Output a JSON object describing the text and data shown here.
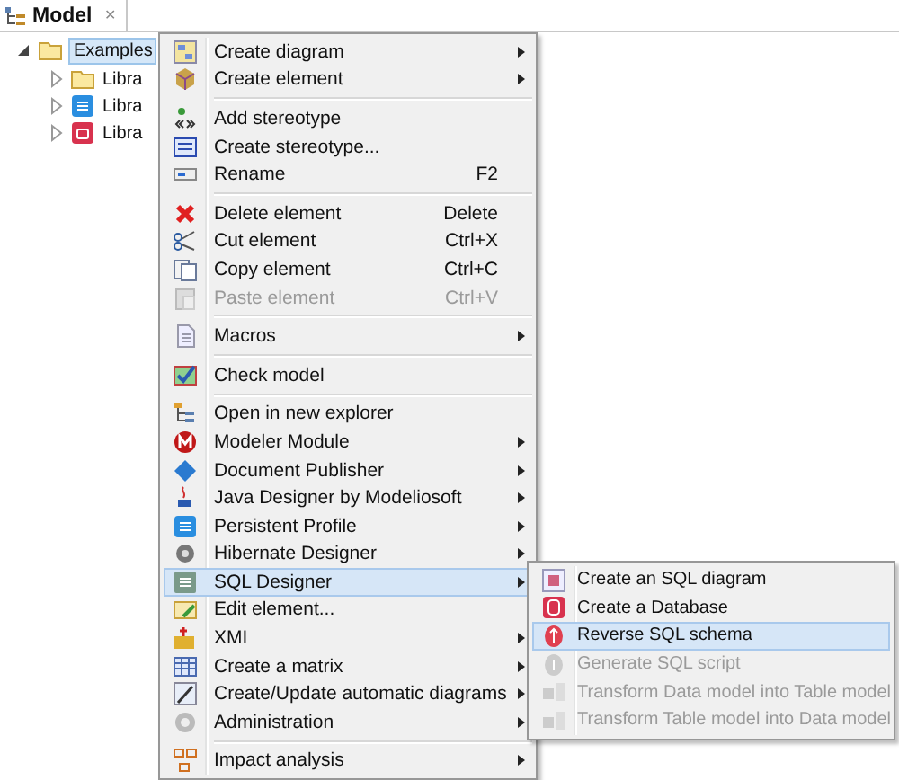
{
  "tab": {
    "title": "Model",
    "close": "✕"
  },
  "tree": [
    {
      "label": "Examples",
      "selected": true,
      "expanded": true,
      "children": [
        {
          "label": "Libra",
          "expanded": false,
          "selected": false
        },
        {
          "label": "Libra",
          "expanded": false,
          "selected": false
        },
        {
          "label": "Libra",
          "expanded": false,
          "selected": false
        }
      ]
    }
  ],
  "context_menu": {
    "items": [
      {
        "kind": "item",
        "label": "Create diagram",
        "submenu": true
      },
      {
        "kind": "item",
        "label": "Create element",
        "submenu": true
      },
      {
        "kind": "separator"
      },
      {
        "kind": "item",
        "label": "Add stereotype"
      },
      {
        "kind": "item",
        "label": "Create stereotype..."
      },
      {
        "kind": "item",
        "label": "Rename",
        "shortcut": "F2"
      },
      {
        "kind": "separator"
      },
      {
        "kind": "item",
        "label": "Delete element",
        "shortcut": "Delete"
      },
      {
        "kind": "item",
        "label": "Cut element",
        "shortcut": "Ctrl+X"
      },
      {
        "kind": "item",
        "label": "Copy element",
        "shortcut": "Ctrl+C"
      },
      {
        "kind": "item",
        "label": "Paste element",
        "shortcut": "Ctrl+V",
        "disabled": true
      },
      {
        "kind": "separator"
      },
      {
        "kind": "item",
        "label": "Macros",
        "submenu": true
      },
      {
        "kind": "separator"
      },
      {
        "kind": "item",
        "label": "Check model"
      },
      {
        "kind": "separator"
      },
      {
        "kind": "item",
        "label": "Open in new explorer"
      },
      {
        "kind": "item",
        "label": "Modeler Module",
        "submenu": true
      },
      {
        "kind": "item",
        "label": "Document Publisher",
        "submenu": true
      },
      {
        "kind": "item",
        "label": "Java Designer by Modeliosoft",
        "submenu": true
      },
      {
        "kind": "item",
        "label": "Persistent Profile",
        "submenu": true
      },
      {
        "kind": "item",
        "label": "Hibernate Designer",
        "submenu": true
      },
      {
        "kind": "item",
        "label": "SQL Designer",
        "submenu": true,
        "selected": true
      },
      {
        "kind": "item",
        "label": "Edit element..."
      },
      {
        "kind": "item",
        "label": "XMI",
        "submenu": true
      },
      {
        "kind": "item",
        "label": "Create a matrix",
        "submenu": true
      },
      {
        "kind": "item",
        "label": "Create/Update automatic diagrams",
        "submenu": true
      },
      {
        "kind": "item",
        "label": "Administration",
        "submenu": true
      },
      {
        "kind": "separator"
      },
      {
        "kind": "item",
        "label": "Impact analysis",
        "submenu": true
      }
    ]
  },
  "submenu": {
    "items": [
      {
        "kind": "item",
        "label": "Create an SQL diagram"
      },
      {
        "kind": "item",
        "label": "Create a Database"
      },
      {
        "kind": "item",
        "label": "Reverse SQL schema",
        "selected": true
      },
      {
        "kind": "item",
        "label": "Generate SQL script",
        "disabled": true
      },
      {
        "kind": "item",
        "label": "Transform Data model into Table model",
        "disabled": true
      },
      {
        "kind": "item",
        "label": "Transform Table model into Data model",
        "disabled": true
      }
    ]
  }
}
